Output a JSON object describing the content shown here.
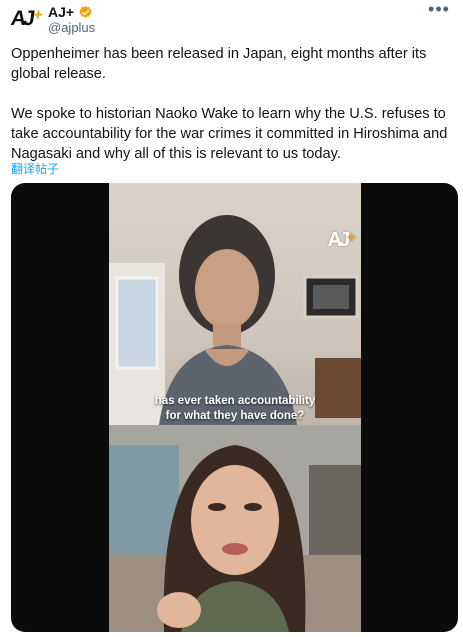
{
  "tweet": {
    "display_name": "AJ+",
    "handle": "@ajplus",
    "verified_color": "#f6a000",
    "avatar_logo": "AJ",
    "avatar_plus": "+",
    "paragraphs": [
      "Oppenheimer has been released in Japan, eight months after its global release.",
      "We spoke to historian Naoko Wake to learn why the U.S. refuses to take accountability for the war crimes it committed in Hiroshima and Nagasaki and why all of this is relevant to us today."
    ],
    "translate_label": "翻译帖子",
    "more_icon": "more-dots-icon"
  },
  "video": {
    "watermark": "AJ",
    "watermark_plus": "+",
    "caption_line1": "has ever taken accountability",
    "caption_line2": "for what they have done?"
  },
  "colors": {
    "link": "#1d9bf0",
    "text": "#0f1419",
    "secondary": "#536471",
    "brand_accent": "#f6a000"
  }
}
